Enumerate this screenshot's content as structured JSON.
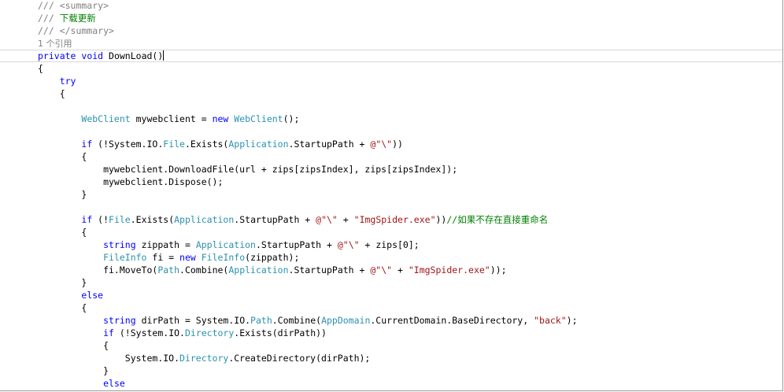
{
  "colors": {
    "keyword": "#0000ff",
    "type": "#2b91af",
    "string": "#a31515",
    "comment": "#008000",
    "doc_tag": "#808080",
    "codelens": "#808080"
  },
  "code": {
    "lines": [
      [
        {
          "t": "/// <summary>",
          "c": "dc"
        }
      ],
      [
        {
          "t": "/// ",
          "c": "dc"
        },
        {
          "t": "下载更新",
          "c": "cm"
        }
      ],
      [
        {
          "t": "/// </summary>",
          "c": "dc"
        }
      ],
      [
        {
          "t": "1 个引用",
          "c": "rf"
        }
      ],
      [
        {
          "t": "private",
          "c": "kw"
        },
        {
          "t": " "
        },
        {
          "t": "void",
          "c": "kw"
        },
        {
          "t": " DownLoad()"
        }
      ],
      [
        {
          "t": "{"
        }
      ],
      [
        {
          "t": "    "
        },
        {
          "t": "try",
          "c": "kw"
        }
      ],
      [
        {
          "t": "    {"
        }
      ],
      [],
      [
        {
          "t": "        "
        },
        {
          "t": "WebClient",
          "c": "ty"
        },
        {
          "t": " mywebclient = "
        },
        {
          "t": "new",
          "c": "kw"
        },
        {
          "t": " "
        },
        {
          "t": "WebClient",
          "c": "ty"
        },
        {
          "t": "();"
        }
      ],
      [],
      [
        {
          "t": "        "
        },
        {
          "t": "if",
          "c": "kw"
        },
        {
          "t": " (!System.IO."
        },
        {
          "t": "File",
          "c": "ty"
        },
        {
          "t": ".Exists("
        },
        {
          "t": "Application",
          "c": "ty"
        },
        {
          "t": ".StartupPath + "
        },
        {
          "t": "@\"\\\"",
          "c": "st"
        },
        {
          "t": "))"
        }
      ],
      [
        {
          "t": "        {"
        }
      ],
      [
        {
          "t": "            mywebclient.DownloadFile(url + zips[zipsIndex], zips[zipsIndex]);"
        }
      ],
      [
        {
          "t": "            mywebclient.Dispose();"
        }
      ],
      [
        {
          "t": "        }"
        }
      ],
      [],
      [
        {
          "t": "        "
        },
        {
          "t": "if",
          "c": "kw"
        },
        {
          "t": " (!"
        },
        {
          "t": "File",
          "c": "ty"
        },
        {
          "t": ".Exists("
        },
        {
          "t": "Application",
          "c": "ty"
        },
        {
          "t": ".StartupPath + "
        },
        {
          "t": "@\"\\\"",
          "c": "st"
        },
        {
          "t": " + "
        },
        {
          "t": "\"ImgSpider.exe\"",
          "c": "st"
        },
        {
          "t": "))"
        },
        {
          "t": "//如果不存在直接重命名",
          "c": "cm"
        }
      ],
      [
        {
          "t": "        {"
        }
      ],
      [
        {
          "t": "            "
        },
        {
          "t": "string",
          "c": "kw"
        },
        {
          "t": " zippath = "
        },
        {
          "t": "Application",
          "c": "ty"
        },
        {
          "t": ".StartupPath + "
        },
        {
          "t": "@\"\\\"",
          "c": "st"
        },
        {
          "t": " + zips[0];"
        }
      ],
      [
        {
          "t": "            "
        },
        {
          "t": "FileInfo",
          "c": "ty"
        },
        {
          "t": " fi = "
        },
        {
          "t": "new",
          "c": "kw"
        },
        {
          "t": " "
        },
        {
          "t": "FileInfo",
          "c": "ty"
        },
        {
          "t": "(zippath);"
        }
      ],
      [
        {
          "t": "            fi.MoveTo("
        },
        {
          "t": "Path",
          "c": "ty"
        },
        {
          "t": ".Combine("
        },
        {
          "t": "Application",
          "c": "ty"
        },
        {
          "t": ".StartupPath + "
        },
        {
          "t": "@\"\\\"",
          "c": "st"
        },
        {
          "t": " + "
        },
        {
          "t": "\"ImgSpider.exe\"",
          "c": "st"
        },
        {
          "t": "));"
        }
      ],
      [
        {
          "t": "        }"
        }
      ],
      [
        {
          "t": "        "
        },
        {
          "t": "else",
          "c": "kw"
        }
      ],
      [
        {
          "t": "        {"
        }
      ],
      [
        {
          "t": "            "
        },
        {
          "t": "string",
          "c": "kw"
        },
        {
          "t": " dirPath = System.IO."
        },
        {
          "t": "Path",
          "c": "ty"
        },
        {
          "t": ".Combine("
        },
        {
          "t": "AppDomain",
          "c": "ty"
        },
        {
          "t": ".CurrentDomain.BaseDirectory, "
        },
        {
          "t": "\"back\"",
          "c": "st"
        },
        {
          "t": ");"
        }
      ],
      [
        {
          "t": "            "
        },
        {
          "t": "if",
          "c": "kw"
        },
        {
          "t": " (!System.IO."
        },
        {
          "t": "Directory",
          "c": "ty"
        },
        {
          "t": ".Exists(dirPath))"
        }
      ],
      [
        {
          "t": "            {"
        }
      ],
      [
        {
          "t": "                System.IO."
        },
        {
          "t": "Directory",
          "c": "ty"
        },
        {
          "t": ".CreateDirectory(dirPath);"
        }
      ],
      [
        {
          "t": "            }"
        }
      ],
      [
        {
          "t": "            "
        },
        {
          "t": "else",
          "c": "kw"
        }
      ]
    ]
  }
}
